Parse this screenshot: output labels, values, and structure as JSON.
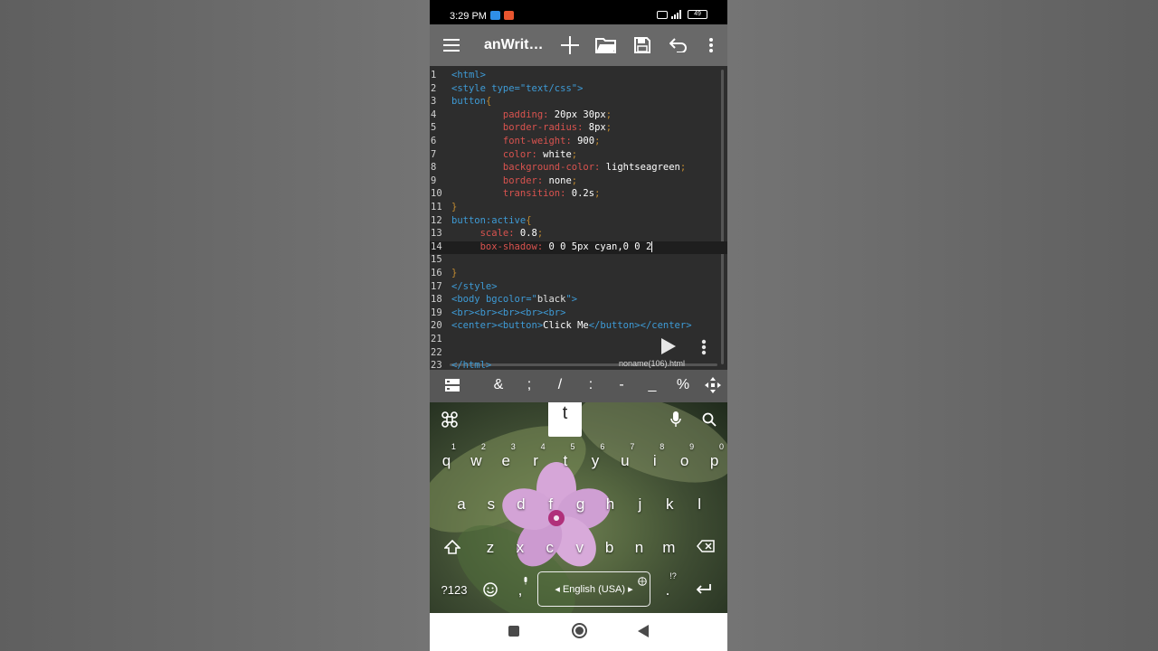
{
  "status_bar": {
    "time": "3:29 PM",
    "battery": "49"
  },
  "toolbar": {
    "title": "anWrit…"
  },
  "editor": {
    "lines": [
      {
        "n": "1",
        "tokens": [
          [
            "tag",
            "<html>"
          ]
        ]
      },
      {
        "n": "2",
        "tokens": [
          [
            "tag",
            "<style "
          ],
          [
            "attr",
            "type="
          ],
          [
            "tag",
            "\"text/css\">"
          ]
        ]
      },
      {
        "n": "3",
        "tokens": [
          [
            "sel",
            "button"
          ],
          [
            "punc",
            "{"
          ]
        ]
      },
      {
        "n": "4",
        "tokens": [
          [
            "txt",
            "         "
          ],
          [
            "prop",
            "padding:"
          ],
          [
            "val",
            " 20px 30px"
          ],
          [
            "punc",
            ";"
          ]
        ]
      },
      {
        "n": "5",
        "tokens": [
          [
            "txt",
            "         "
          ],
          [
            "prop",
            "border-radius:"
          ],
          [
            "val",
            " 8px"
          ],
          [
            "punc",
            ";"
          ]
        ]
      },
      {
        "n": "6",
        "tokens": [
          [
            "txt",
            "         "
          ],
          [
            "prop",
            "font-weight:"
          ],
          [
            "val",
            " 900"
          ],
          [
            "punc",
            ";"
          ]
        ]
      },
      {
        "n": "7",
        "tokens": [
          [
            "txt",
            "         "
          ],
          [
            "prop",
            "color:"
          ],
          [
            "val",
            " white"
          ],
          [
            "punc",
            ";"
          ]
        ]
      },
      {
        "n": "8",
        "tokens": [
          [
            "txt",
            "         "
          ],
          [
            "prop",
            "background-color:"
          ],
          [
            "val",
            " lightseagreen"
          ],
          [
            "punc",
            ";"
          ]
        ]
      },
      {
        "n": "9",
        "tokens": [
          [
            "txt",
            "         "
          ],
          [
            "prop",
            "border:"
          ],
          [
            "val",
            " none"
          ],
          [
            "punc",
            ";"
          ]
        ]
      },
      {
        "n": "10",
        "tokens": [
          [
            "txt",
            "         "
          ],
          [
            "prop",
            "transition:"
          ],
          [
            "val",
            " 0.2s"
          ],
          [
            "punc",
            ";"
          ]
        ]
      },
      {
        "n": "11",
        "tokens": [
          [
            "punc",
            "}"
          ]
        ]
      },
      {
        "n": "12",
        "tokens": [
          [
            "sel",
            "button:active"
          ],
          [
            "punc",
            "{"
          ]
        ]
      },
      {
        "n": "13",
        "tokens": [
          [
            "txt",
            "     "
          ],
          [
            "prop",
            "scale:"
          ],
          [
            "val",
            " 0.8"
          ],
          [
            "punc",
            ";"
          ]
        ]
      },
      {
        "n": "14",
        "tokens": [
          [
            "txt",
            "     "
          ],
          [
            "prop",
            "box-shadow:"
          ],
          [
            "val",
            " 0 0 5px cyan,0 0 2"
          ]
        ]
      },
      {
        "n": "15",
        "tokens": []
      },
      {
        "n": "16",
        "tokens": [
          [
            "punc",
            "}"
          ]
        ]
      },
      {
        "n": "17",
        "tokens": [
          [
            "tag",
            "</style>"
          ]
        ]
      },
      {
        "n": "18",
        "tokens": [
          [
            "tag",
            "<body "
          ],
          [
            "attr",
            "bgcolor="
          ],
          [
            "tag",
            "\""
          ],
          [
            "str",
            "black"
          ],
          [
            "tag",
            "\">"
          ]
        ]
      },
      {
        "n": "19",
        "tokens": [
          [
            "tag",
            "<br><br><br><br><br>"
          ]
        ]
      },
      {
        "n": "20",
        "tokens": [
          [
            "tag",
            "<center><button>"
          ],
          [
            "txt",
            "Click Me"
          ],
          [
            "tag",
            "</button></center>"
          ]
        ]
      },
      {
        "n": "21",
        "tokens": []
      },
      {
        "n": "22",
        "tokens": []
      },
      {
        "n": "23",
        "tokens": [
          [
            "tag",
            "</html>"
          ]
        ]
      }
    ],
    "current_line": "14",
    "filename": "noname(106).html"
  },
  "symbol_bar": [
    "&",
    ";",
    "/",
    ":",
    "-",
    "_",
    "%"
  ],
  "keyboard": {
    "popup_key": "t",
    "row1": [
      "q",
      "w",
      "e",
      "r",
      "t",
      "y",
      "u",
      "i",
      "o",
      "p"
    ],
    "row1_hints": [
      "1",
      "2",
      "3",
      "4",
      "5",
      "6",
      "7",
      "8",
      "9",
      "0"
    ],
    "row2": [
      "a",
      "s",
      "d",
      "f",
      "g",
      "h",
      "j",
      "k",
      "l"
    ],
    "row3": [
      "z",
      "x",
      "c",
      "v",
      "b",
      "n",
      "m"
    ],
    "symbols_key": "?123",
    "comma_key": ",",
    "space_label": "English (USA)",
    "period_key": ".",
    "period_hint": "!?"
  }
}
